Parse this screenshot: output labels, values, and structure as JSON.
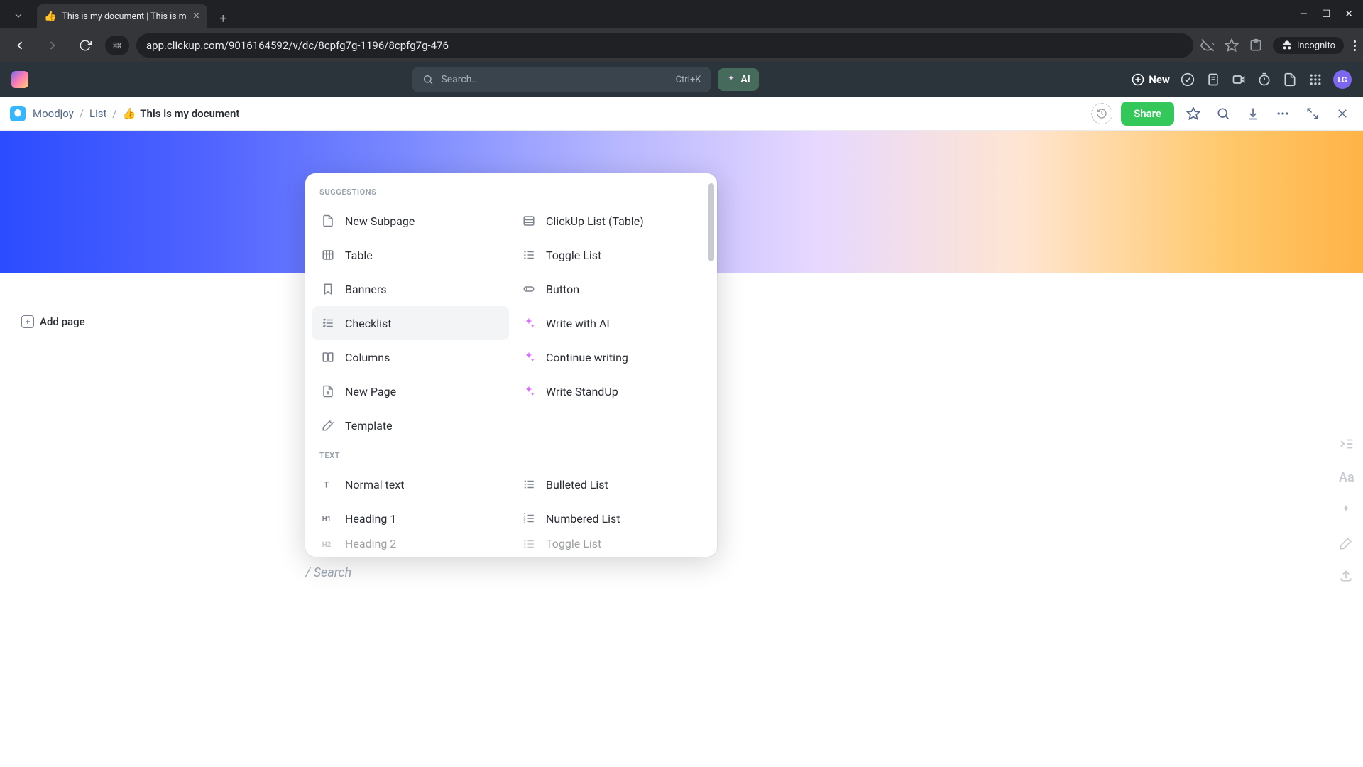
{
  "browser": {
    "tab_title": "This is my document | This is m",
    "tab_favicon": "👍",
    "url": "app.clickup.com/9016164592/v/dc/8cpfg7g-1196/8cpfg7g-476",
    "incognito_label": "Incognito"
  },
  "topbar": {
    "search_placeholder": "Search...",
    "search_shortcut": "Ctrl+K",
    "ai_label": "AI",
    "new_label": "New",
    "avatar_initials": "LG"
  },
  "breadcrumb": {
    "workspace": "Moodjoy",
    "list": "List",
    "doc_icon": "👍",
    "doc_title": "This is my document",
    "share_label": "Share"
  },
  "sidebar": {
    "add_page_label": "Add page"
  },
  "popup": {
    "sections": {
      "suggestions_label": "SUGGESTIONS",
      "text_label": "TEXT"
    },
    "suggestions_left": [
      {
        "icon": "page",
        "label": "New Subpage"
      },
      {
        "icon": "table",
        "label": "Table"
      },
      {
        "icon": "bookmark",
        "label": "Banners"
      },
      {
        "icon": "checklist",
        "label": "Checklist",
        "hover": true
      },
      {
        "icon": "columns",
        "label": "Columns"
      },
      {
        "icon": "newpage",
        "label": "New Page"
      },
      {
        "icon": "wand",
        "label": "Template"
      }
    ],
    "suggestions_right": [
      {
        "icon": "tablelist",
        "label": "ClickUp List (Table)"
      },
      {
        "icon": "togglelist",
        "label": "Toggle List"
      },
      {
        "icon": "button",
        "label": "Button"
      },
      {
        "icon": "ai",
        "label": "Write with AI"
      },
      {
        "icon": "ai",
        "label": "Continue writing"
      },
      {
        "icon": "ai",
        "label": "Write StandUp"
      }
    ],
    "text_left": [
      {
        "icon": "text",
        "label": "Normal text"
      },
      {
        "icon": "h1",
        "label": "Heading 1"
      },
      {
        "icon": "h2",
        "label": "Heading 2",
        "cutoff": true
      }
    ],
    "text_right": [
      {
        "icon": "bulleted",
        "label": "Bulleted List"
      },
      {
        "icon": "numbered",
        "label": "Numbered List"
      },
      {
        "icon": "togglelist",
        "label": "Toggle List",
        "cutoff": true
      }
    ],
    "search_hint": "/ Search"
  }
}
